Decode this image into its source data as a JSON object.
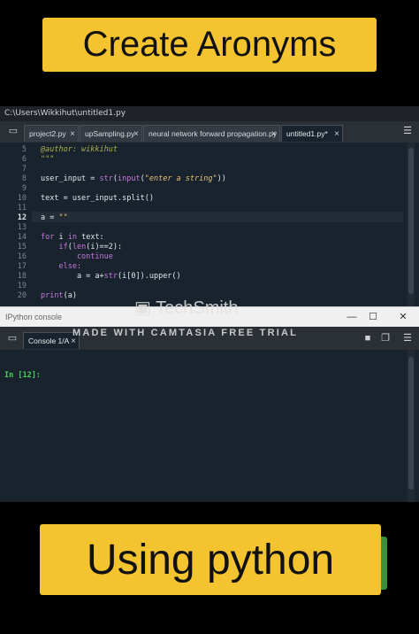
{
  "banners": {
    "top": "Create Aronyms",
    "bottom": "Using python"
  },
  "editor": {
    "path": "C:\\Users\\Wikkihut\\untitled1.py",
    "tabs": [
      {
        "label": "project2.py",
        "close": "×"
      },
      {
        "label": "upSampling.py",
        "close": "×"
      },
      {
        "label": "neural network forward propagation.py",
        "close": "×"
      },
      {
        "label": "untitled1.py*",
        "close": "×"
      }
    ],
    "line_numbers": [
      "5",
      "6",
      "7",
      "8",
      "9",
      "10",
      "11",
      "12",
      "13",
      "14",
      "15",
      "16",
      "17",
      "18",
      "19",
      "20"
    ],
    "current_line": "12",
    "code": {
      "l5": "@author: wikkihut",
      "l6": "\"\"\"",
      "l8_a": "user_input = ",
      "l8_b": "str",
      "l8_c": "(",
      "l8_d": "input",
      "l8_e": "(",
      "l8_f": "\"enter a string\"",
      "l8_g": "))",
      "l10": "text = user_input.split()",
      "l12_a": "a = ",
      "l12_b": "\"\"",
      "l14_a": "for",
      "l14_b": " i ",
      "l14_c": "in",
      "l14_d": " text:",
      "l15_a": "    if",
      "l15_b": "(",
      "l15_c": "len",
      "l15_d": "(i)==2):",
      "l16": "        continue",
      "l17": "    else:",
      "l18_a": "        a = a+",
      "l18_b": "str",
      "l18_c": "(i[0]).upper()",
      "l20_a": "print",
      "l20_b": "(a)"
    }
  },
  "console": {
    "title": "IPython console",
    "tab": {
      "label": "Console 1/A",
      "close": "×"
    },
    "prompt": "In [12]:"
  },
  "watermark": {
    "logo": "TechSmith",
    "text": "MADE WITH CAMTASIA FREE TRIAL"
  },
  "window_buttons": {
    "minimize": "—",
    "maximize": "☐",
    "close": "✕"
  }
}
